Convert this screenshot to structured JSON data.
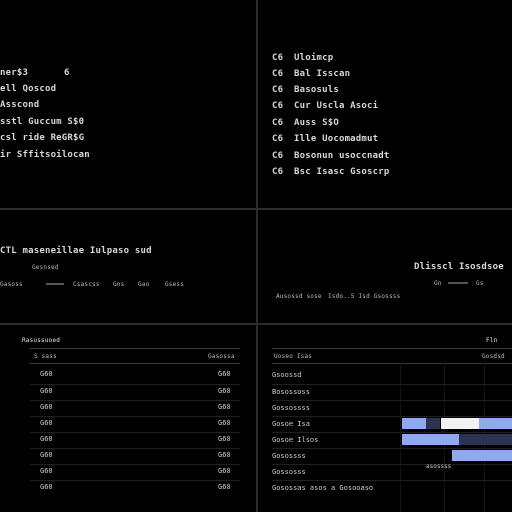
{
  "theme": {
    "background": "#000000",
    "text": "#d8d8d8",
    "divider": "#2c2c2c",
    "accent_blue": "#8fa9ee",
    "accent_white": "#f2f2f2",
    "accent_dark": "#2a3350"
  },
  "top_left": {
    "header_value": "6",
    "lines": [
      "ner$3",
      "ell Qoscod",
      "Asscond",
      "sstl Guccum S$0",
      "csl ride ReGR$G",
      "ir Sffitsoilocan"
    ]
  },
  "top_right": {
    "rows": [
      {
        "marker": "C6",
        "label": "Uloimcp"
      },
      {
        "marker": "C6",
        "label": "Bal Isscan"
      },
      {
        "marker": "C6",
        "label": "Basosuls"
      },
      {
        "marker": "C6",
        "label": "Cur Uscla Asoci"
      },
      {
        "marker": "C6",
        "label": "Auss S$O"
      },
      {
        "marker": "C6",
        "label": "Ille Uocomadmut"
      },
      {
        "marker": "C6",
        "label": "Bosonun usoccnadt"
      },
      {
        "marker": "C6",
        "label": "Bsc Isasc Gsoscrp"
      }
    ]
  },
  "mid_left": {
    "title": "CTL maseneillae Iulpaso sud",
    "subtitle": "Gesnsed",
    "stats": [
      "Gasoss",
      "Csascss",
      "Gns",
      "Gao",
      "Gsess"
    ]
  },
  "mid_right": {
    "title": "Dlisscl Isosdsoe",
    "stats": [
      "Ausossd sose",
      "Isdo..5 Isd Gsossss",
      "Gn",
      "Gs"
    ]
  },
  "bottom_left": {
    "section": "Rasussuoed",
    "col_left": "S sass",
    "col_right": "Gasossa",
    "rows": [
      {
        "a": "G60",
        "b": "G60"
      },
      {
        "a": "G60",
        "b": "G60"
      },
      {
        "a": "G60",
        "b": "G60"
      },
      {
        "a": "G60",
        "b": "G60"
      },
      {
        "a": "G60",
        "b": "G60"
      },
      {
        "a": "G60",
        "b": "G60"
      },
      {
        "a": "G60",
        "b": "G60"
      },
      {
        "a": "G60",
        "b": "G60"
      }
    ]
  },
  "bottom_right": {
    "header_right": "Fln",
    "col_left": "Uoseo Isas",
    "col_right": "Gosdsd",
    "rows": [
      "Gsoossd",
      "Bosossoss",
      "Gossossss",
      "Gosoe Isa",
      "Gosoe Ilsos",
      "Gosossss",
      "Gossosss",
      "Gosossas asos a Gosooaso"
    ],
    "row_extra": [
      "",
      "",
      "",
      "",
      "",
      "",
      "asossss",
      ""
    ],
    "bar_series": [
      {
        "row": 3,
        "segments": [
          {
            "from": 0.0,
            "to": 0.22,
            "color": "accent_blue"
          },
          {
            "from": 0.22,
            "to": 0.35,
            "color": "accent_dark"
          },
          {
            "from": 0.35,
            "to": 0.7,
            "color": "accent_white"
          },
          {
            "from": 0.7,
            "to": 1.0,
            "color": "accent_blue"
          }
        ]
      },
      {
        "row": 4,
        "segments": [
          {
            "from": 0.0,
            "to": 0.52,
            "color": "accent_blue"
          },
          {
            "from": 0.52,
            "to": 1.0,
            "color": "accent_dark"
          }
        ]
      },
      {
        "row": 5,
        "segments": [
          {
            "from": 0.45,
            "to": 0.75,
            "color": "accent_blue"
          },
          {
            "from": 0.75,
            "to": 1.0,
            "color": "accent_blue"
          }
        ]
      }
    ]
  }
}
